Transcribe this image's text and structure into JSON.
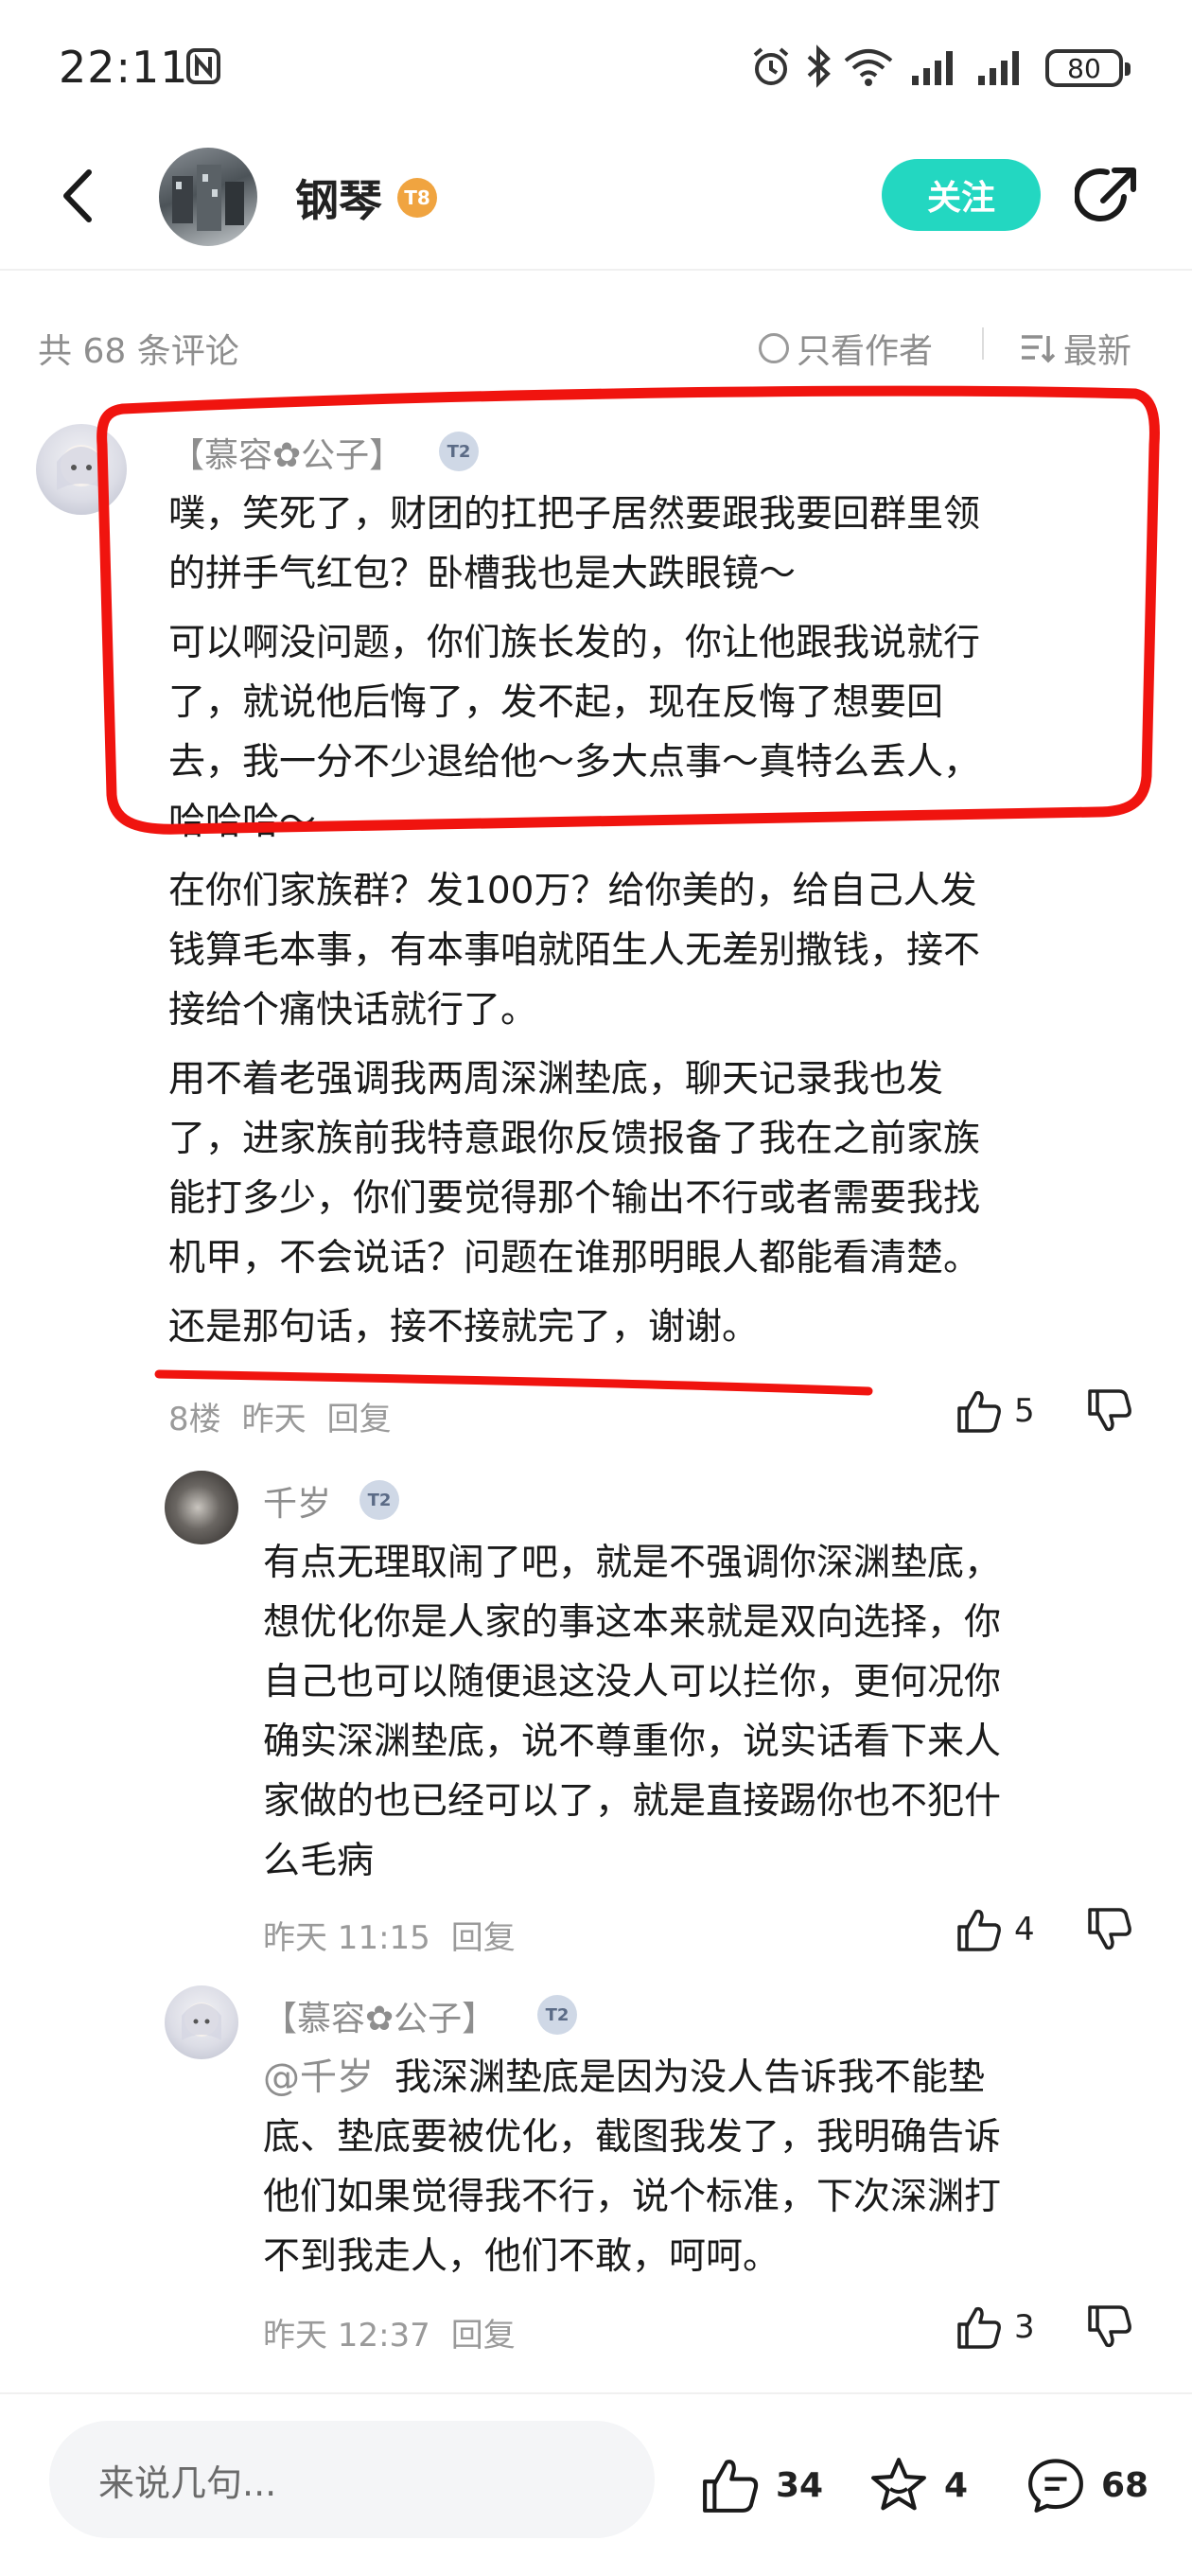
{
  "status_bar": {
    "time": "22:11",
    "battery": "80"
  },
  "header": {
    "title": "钢琴",
    "level_badge": "T8",
    "follow_label": "关注"
  },
  "comment_bar": {
    "count_text": "共 68 条评论",
    "only_author_label": "只看作者",
    "sort_label": "最新"
  },
  "main_comment": {
    "username": "【慕容✿公子】",
    "badge": "T2",
    "paragraphs": [
      [
        "噗，笑死了，财团的扛把子居然要跟我要回群里领",
        "的拼手气红包？卧槽我也是大跌眼镜～"
      ],
      [
        "可以啊没问题，你们族长发的，你让他跟我说就行",
        "了，就说他后悔了，发不起，现在反悔了想要回",
        "去，我一分不少退给他～多大点事～真特么丢人，",
        "哈哈哈～"
      ],
      [
        "在你们家族群？发100万？给你美的，给自己人发",
        "钱算毛本事，有本事咱就陌生人无差别撒钱，接不",
        "接给个痛快话就行了。"
      ],
      [
        "用不着老强调我两周深渊垫底，聊天记录我也发",
        "了，进家族前我特意跟你反馈报备了我在之前家族",
        "能打多少，你们要觉得那个输出不行或者需要我找",
        "机甲，不会说话？问题在谁那明眼人都能看清楚。"
      ],
      [
        "还是那句话，接不接就完了，谢谢。"
      ]
    ],
    "floor": "8楼",
    "time": "昨天",
    "reply_label": "回复",
    "likes": "5"
  },
  "replies": [
    {
      "username": "千岁",
      "badge": "T2",
      "mention": "",
      "lines": [
        "有点无理取闹了吧，就是不强调你深渊垫底，",
        "想优化你是人家的事这本来就是双向选择，你",
        "自己也可以随便退这没人可以拦你，更何况你",
        "确实深渊垫底，说不尊重你，说实话看下来人",
        "家做的也已经可以了，就是直接踢你也不犯什",
        "么毛病"
      ],
      "time": "昨天 11:15",
      "reply_label": "回复",
      "likes": "4"
    },
    {
      "username": "【慕容✿公子】",
      "badge": "T2",
      "mention": "@千岁",
      "lines": [
        "我深渊垫底是因为没人告诉我不能垫",
        "底、垫底要被优化，截图我发了，我明确告诉",
        "他们如果觉得我不行，说个标准，下次深渊打",
        "不到我走人，他们不敢，呵呵。"
      ],
      "time": "昨天 12:37",
      "reply_label": "回复",
      "likes": "3"
    }
  ],
  "bottom_bar": {
    "input_placeholder": "来说几句...",
    "like_count": "34",
    "fav_count": "4",
    "comment_count": "68"
  },
  "colors": {
    "accent": "#23d7c1",
    "mark_red": "#f0140f",
    "muted_text": "#8e8e8e"
  },
  "icons": [
    "nfc-icon",
    "alarm-icon",
    "bluetooth-icon",
    "wifi-icon",
    "signal-icon",
    "back-icon",
    "share-icon",
    "sort-icon",
    "thumb-up-icon",
    "thumb-down-icon",
    "star-icon",
    "comment-icon"
  ]
}
